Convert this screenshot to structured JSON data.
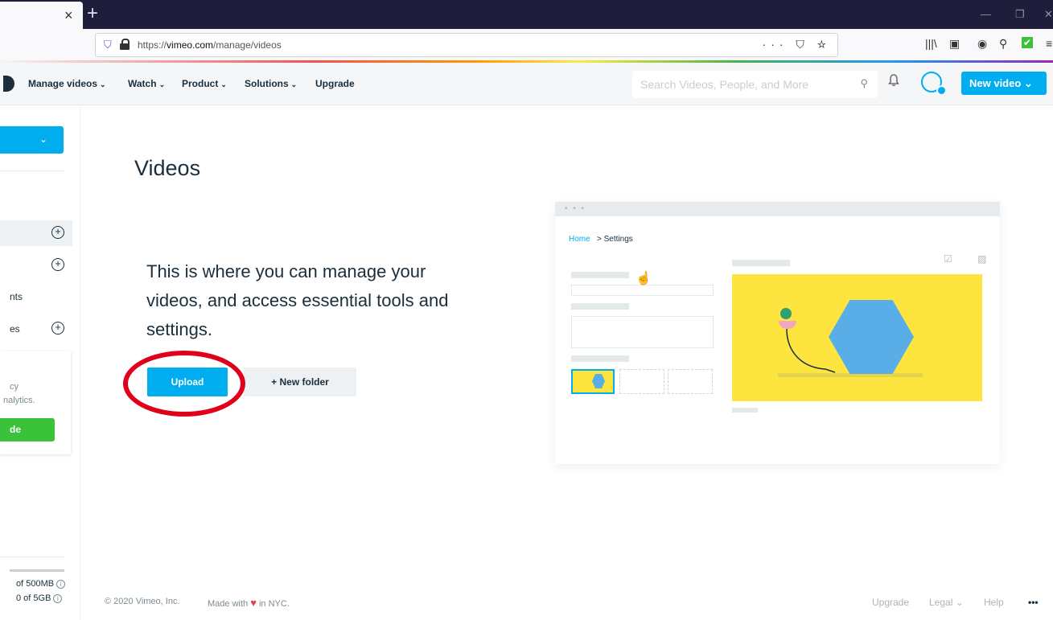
{
  "browser": {
    "tab_close": "×",
    "new_tab": "+",
    "url_prefix": "https://",
    "url_domain": "vimeo.com",
    "url_path": "/manage/videos",
    "url_actions": "··· ⛉ ☆",
    "win_min": "—",
    "win_restore": "❐",
    "win_close": "✕",
    "toolbar_icons": [
      "|||\\",
      "▣",
      "◉",
      "⚲",
      "✔",
      "≡"
    ]
  },
  "header": {
    "nav": [
      {
        "label": "Manage videos"
      },
      {
        "label": "Watch"
      },
      {
        "label": "Product"
      },
      {
        "label": "Solutions"
      },
      {
        "label": "Upgrade"
      }
    ],
    "chev": "⌄",
    "search_placeholder": "Search Videos, People, and More",
    "search_icon": "⚲",
    "bell_icon": "🔔",
    "new_video_label": "New video ⌄"
  },
  "sidebar": {
    "top_button_chev": "⌄",
    "plus": "+",
    "item_nts": "nts",
    "item_es": "es",
    "card_line1": "cy",
    "card_line2": "nalytics.",
    "card_button": "de",
    "storage1": "of 500MB",
    "storage2": "0 of 5GB",
    "info": "i"
  },
  "main": {
    "title": "Videos",
    "description": "This is where you can manage your videos, and access essential tools and settings.",
    "upload_label": "Upload",
    "new_folder_label": "+ New folder"
  },
  "illustration": {
    "dots": "• • •",
    "bc_home": "Home",
    "bc_rest": "> Settings",
    "cursor": "☝",
    "icons": "☑ ▨"
  },
  "footer": {
    "copyright": "© 2020 Vimeo, Inc.",
    "made_with": "Made with",
    "heart": "♥",
    "in_nyc": "in NYC.",
    "upgrade": "Upgrade",
    "legal": "Legal ⌄",
    "help": "Help",
    "more": "•••"
  },
  "colors": {
    "accent": "#00adef",
    "upgrade_green": "#3bc23b",
    "annotation_red": "#e0001a"
  }
}
